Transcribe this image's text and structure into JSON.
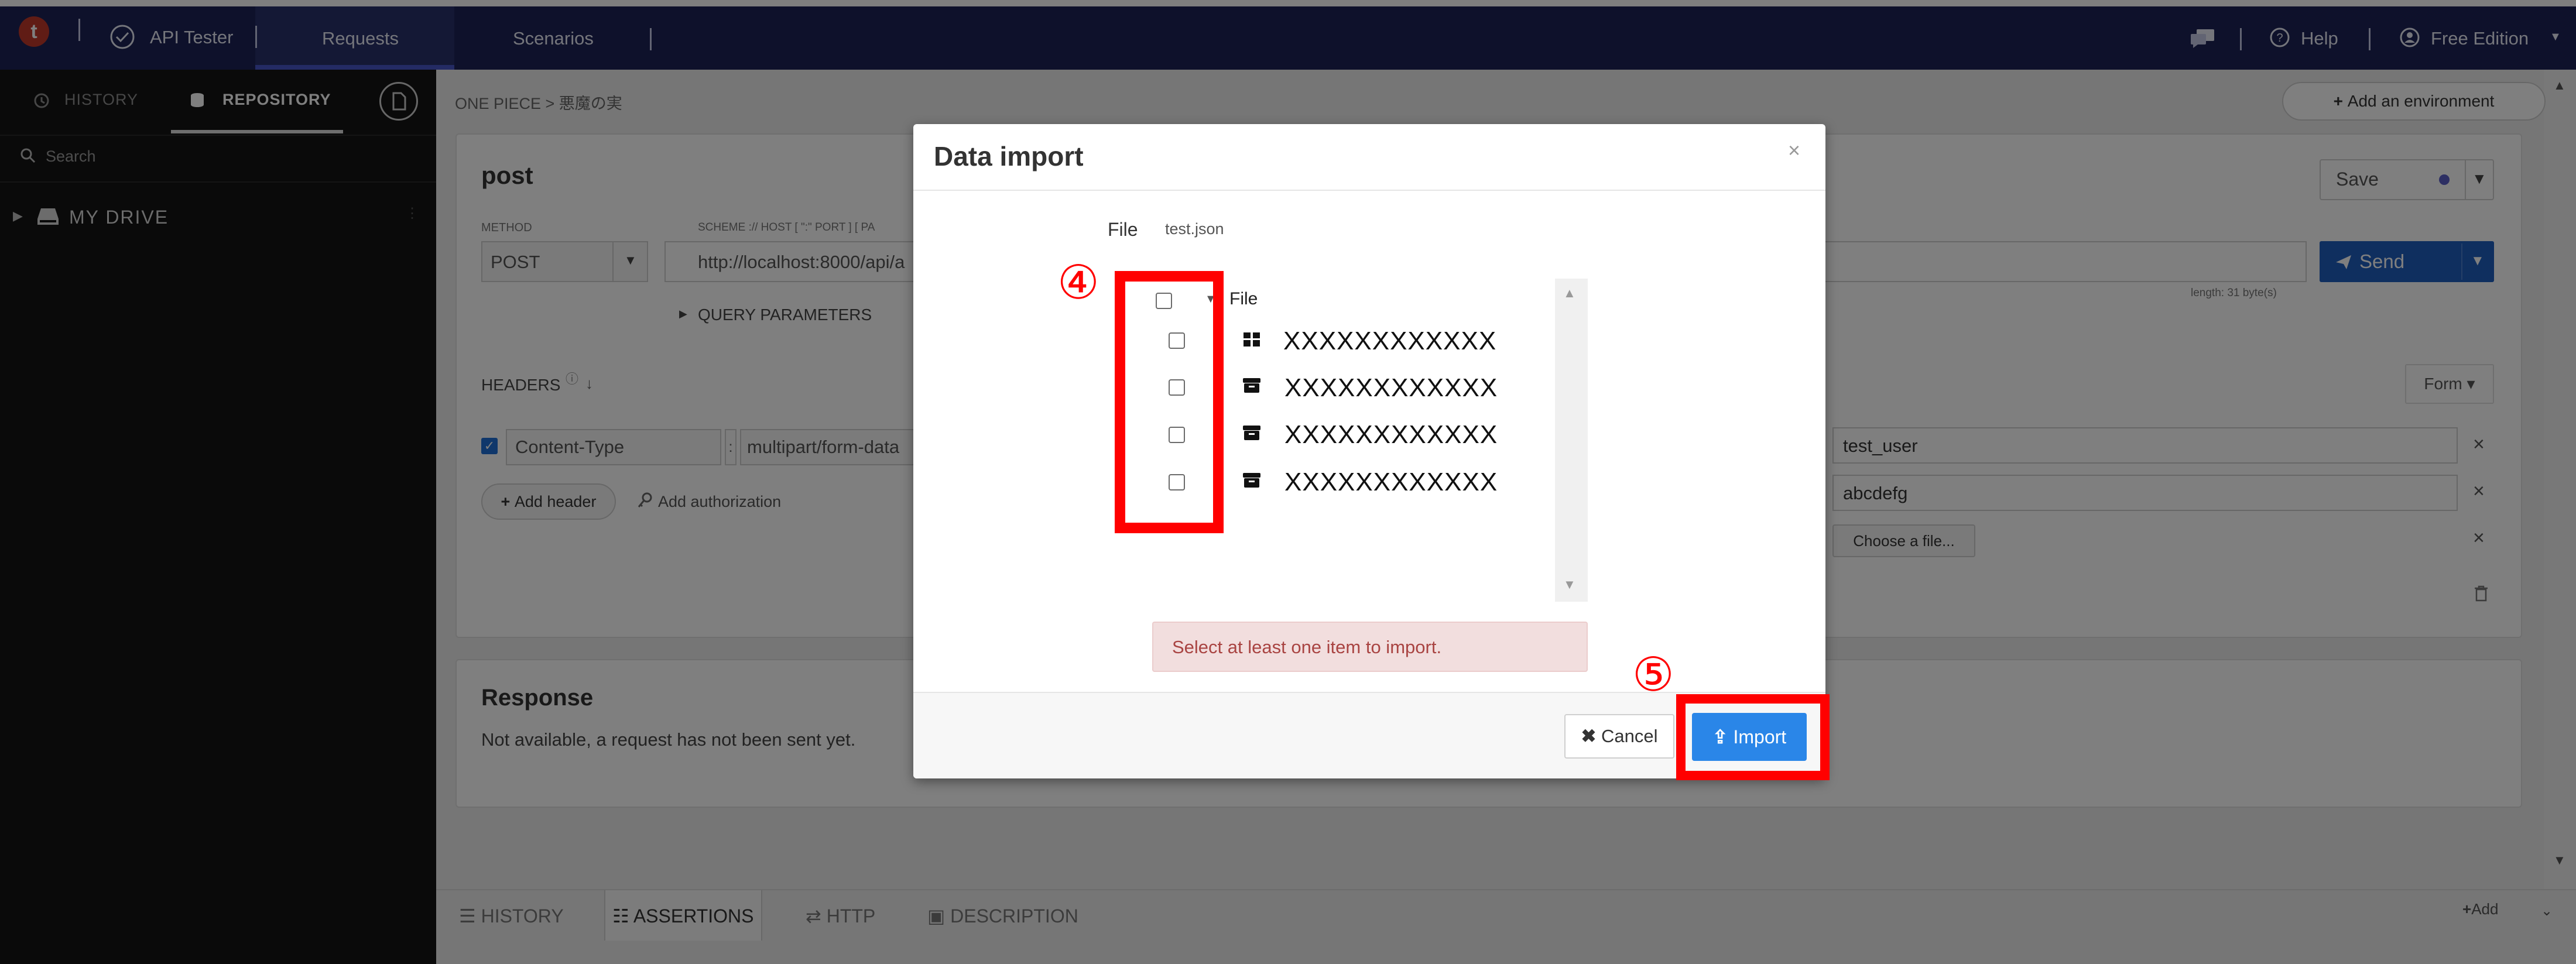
{
  "topbar": {
    "logo_letter": "t",
    "app_name": "API Tester",
    "tabs": [
      {
        "label": "Requests"
      },
      {
        "label": "Scenarios"
      }
    ],
    "help": "Help",
    "edition": "Free Edition"
  },
  "sidebar": {
    "tabs": [
      {
        "label": "HISTORY"
      },
      {
        "label": "REPOSITORY"
      }
    ],
    "search_placeholder": "Search",
    "drive_label": "MY DRIVE"
  },
  "main": {
    "breadcrumb": "ONE PIECE > 悪魔の実",
    "add_environment": "Add an environment",
    "request": {
      "title": "post",
      "save_label": "Save",
      "method_label": "METHOD",
      "method": "POST",
      "scheme_label": "SCHEME :// HOST [ \":\" PORT ] [ PA",
      "url": "http://localhost:8000/api/a",
      "send_label": "Send",
      "length_label": "length: 31 byte(s)",
      "query_params": "QUERY PARAMETERS",
      "headers_label": "HEADERS",
      "header_name": "Content-Type",
      "header_value": "multipart/form-data",
      "add_header": "Add header",
      "add_authorization": "Add authorization",
      "form_label": "Form",
      "body_fields": [
        "test_user",
        "abcdefg"
      ],
      "choose_file": "Choose a file..."
    },
    "response": {
      "title": "Response",
      "message": "Not available, a request has not been sent yet."
    }
  },
  "bottom_tabs": [
    {
      "label": "HISTORY"
    },
    {
      "label": "ASSERTIONS"
    },
    {
      "label": "HTTP"
    },
    {
      "label": "DESCRIPTION"
    }
  ],
  "bottom_add": "Add",
  "modal": {
    "title": "Data import",
    "file_label": "File",
    "file_name": "test.json",
    "tree_root": "File",
    "items": [
      {
        "label": "XXXXXXXXXXXX",
        "icon": "grid-icon"
      },
      {
        "label": "XXXXXXXXXXXX",
        "icon": "archive-icon"
      },
      {
        "label": "XXXXXXXXXXXX",
        "icon": "archive-icon"
      },
      {
        "label": "XXXXXXXXXXXX",
        "icon": "archive-icon"
      }
    ],
    "error": "Select at least one item to import.",
    "cancel": "Cancel",
    "import": "Import"
  },
  "annotations": {
    "step4": "④",
    "step5": "⑤",
    "color": "#ff0000"
  },
  "colors": {
    "topbar": "#1c2356",
    "sidebar": "#141414",
    "send_button": "#1f5fbf",
    "import_button": "#2a86e8",
    "error_bg": "#f2dede"
  }
}
